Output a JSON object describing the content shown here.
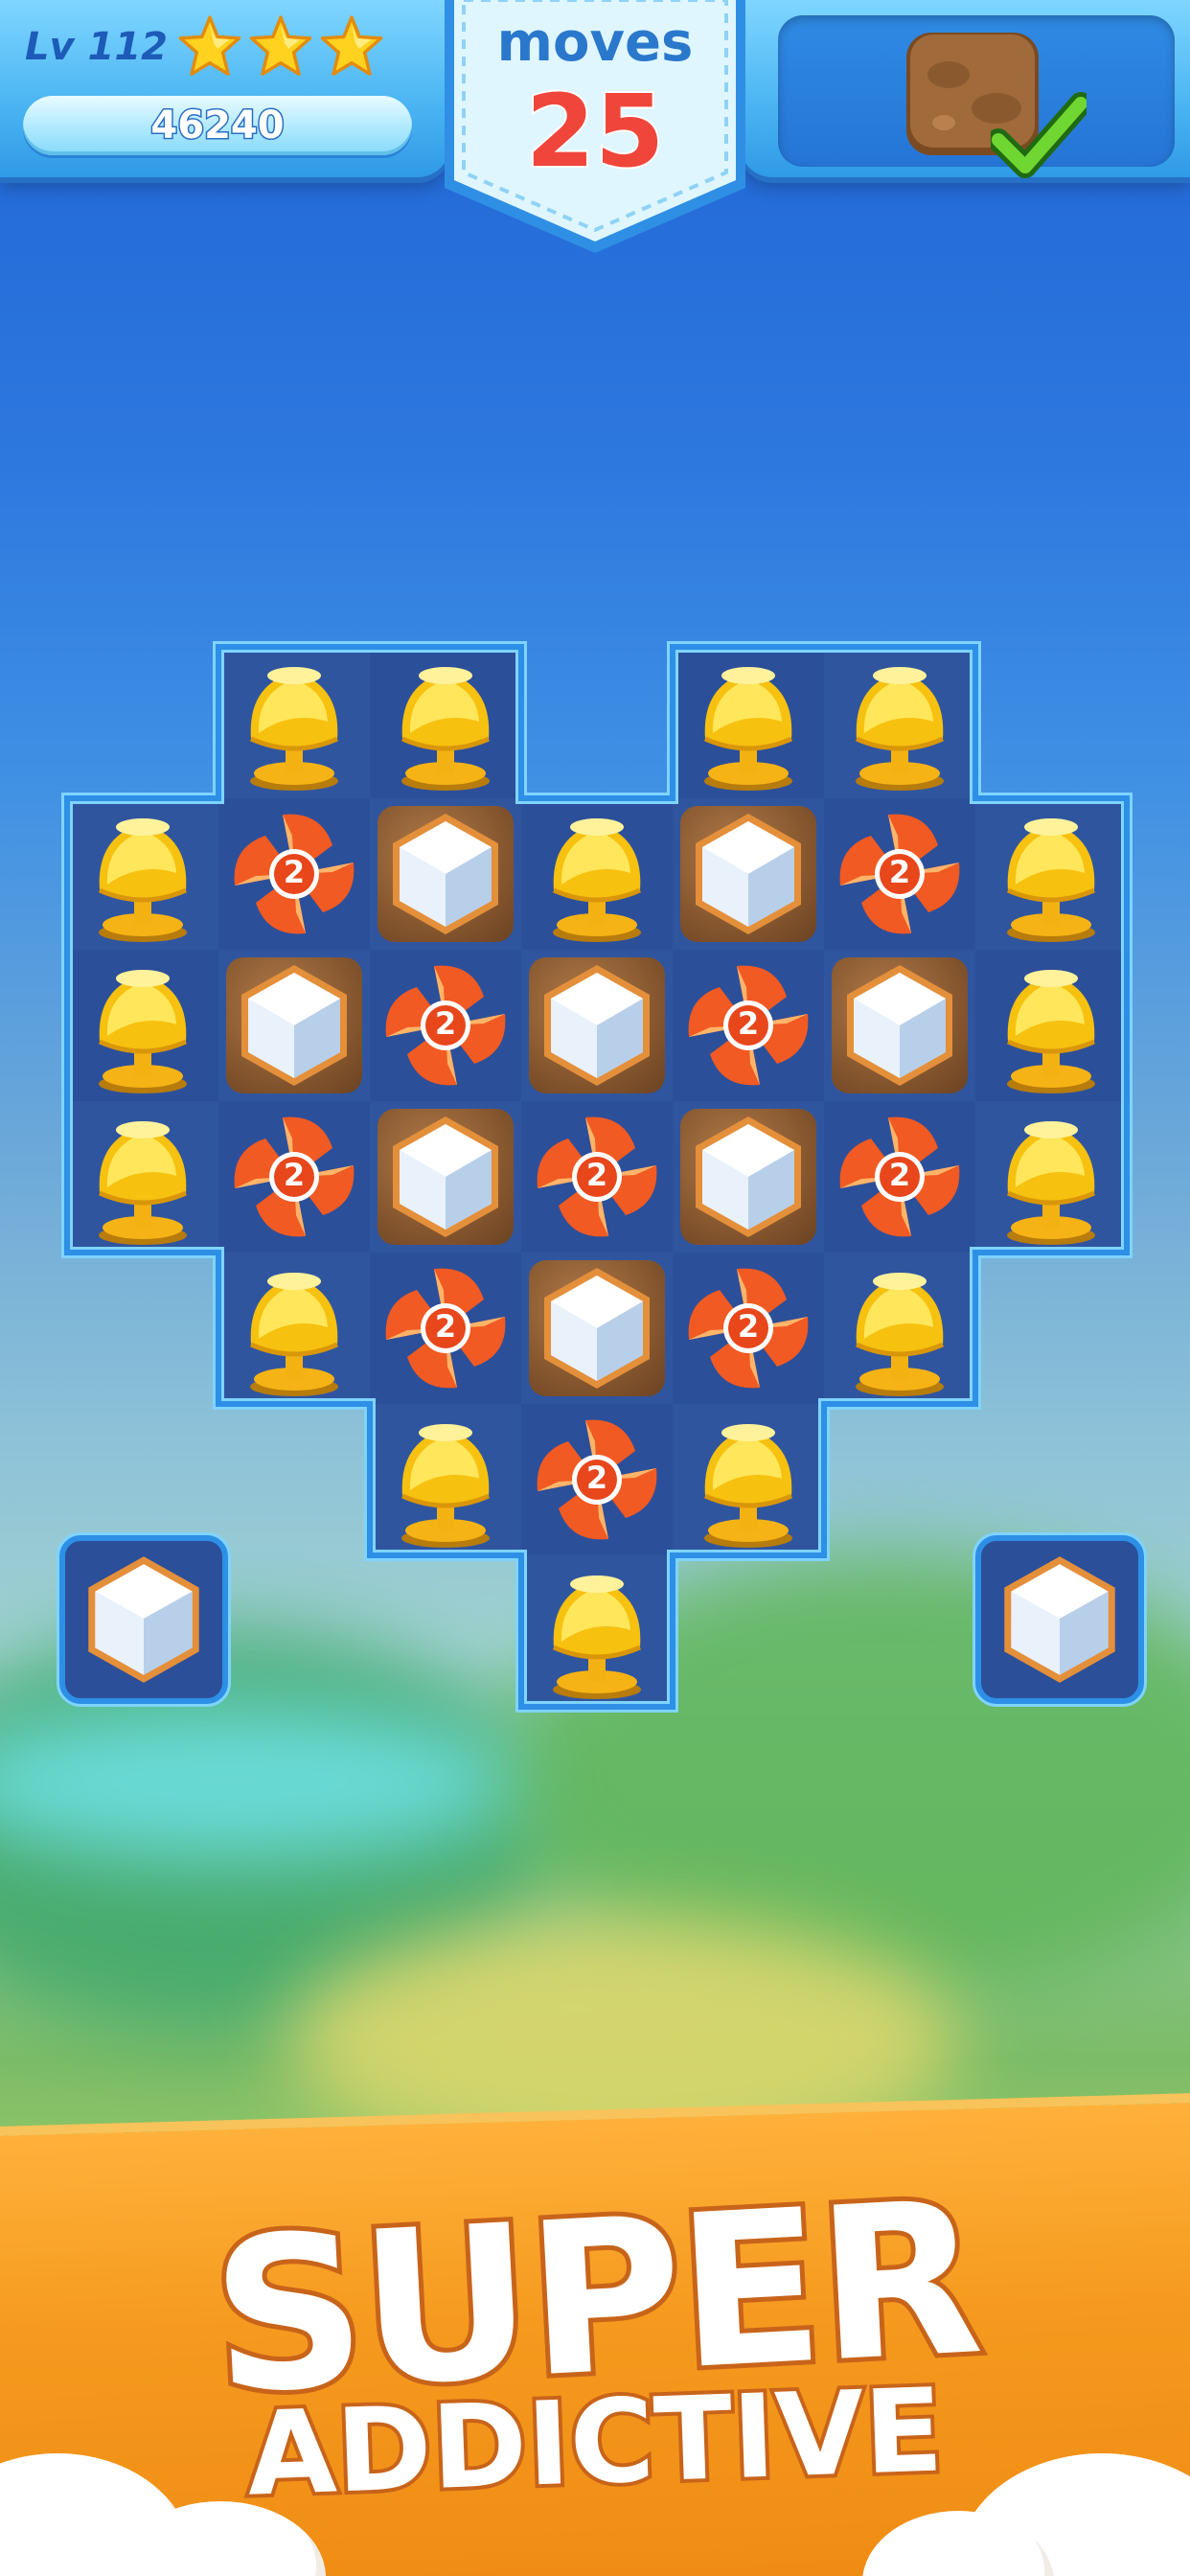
{
  "hud": {
    "level_label": "Lv 112",
    "stars_earned": 3,
    "score": "46240",
    "moves_label": "moves",
    "moves_value": "25",
    "goal_icon": "dirt-block-icon",
    "goal_status": "complete-check-icon"
  },
  "board": {
    "columns": 7,
    "rows": 7,
    "cells": [
      [
        null,
        "lamp",
        "lamp",
        null,
        "lamp",
        "lamp",
        null
      ],
      [
        "lamp",
        "pinwheel",
        "diamond-dirt",
        "lamp",
        "diamond-dirt",
        "pinwheel",
        "lamp"
      ],
      [
        "lamp",
        "diamond-dirt",
        "pinwheel",
        "diamond-dirt",
        "pinwheel",
        "diamond-dirt",
        "lamp"
      ],
      [
        "lamp",
        "pinwheel",
        "diamond-dirt",
        "pinwheel",
        "diamond-dirt",
        "pinwheel",
        "lamp"
      ],
      [
        null,
        "lamp",
        "pinwheel",
        "diamond-dirt",
        "pinwheel",
        "lamp",
        null
      ],
      [
        null,
        null,
        "lamp",
        "pinwheel",
        "lamp",
        null,
        null
      ],
      [
        null,
        null,
        null,
        "lamp",
        null,
        null,
        null
      ]
    ],
    "pinwheel_counter": "2",
    "side_tiles": [
      "diamond",
      "diamond"
    ]
  },
  "banner": {
    "title": "SUPER",
    "subtitle": "ADDICTIVE"
  },
  "colors": {
    "hud_blue": "#4ab4f2",
    "moves_red": "#f0453a",
    "banner_orange": "#f59a1e",
    "cell_navy": "#2c4f9a"
  }
}
